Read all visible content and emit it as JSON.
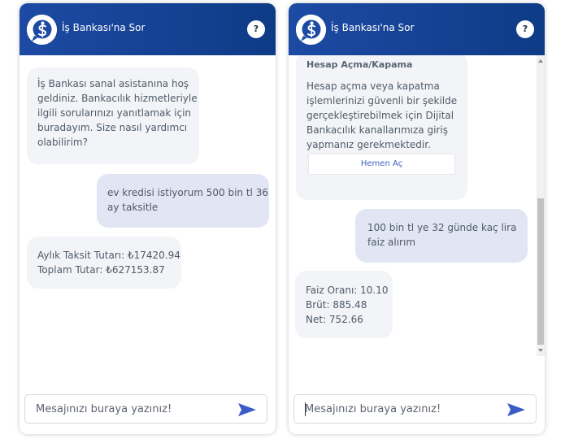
{
  "brand_color": "#1d4aa3",
  "left": {
    "header": {
      "title": "İş Bankası'na Sor",
      "help": "?"
    },
    "messages": [
      {
        "from": "bot",
        "lines": [
          "İş Bankası sanal asistanına hoş",
          "geldiniz. Bankacılık hizmetleriyle",
          "ilgili sorularınızı yanıtlamak için",
          "buradayım. Size nasıl yardımcı",
          "olabilirim?"
        ]
      },
      {
        "from": "user",
        "lines": [
          "ev kredisi istiyorum 500 bin tl 36",
          "ay taksitle"
        ]
      },
      {
        "from": "bot",
        "lines": [
          "Aylık Taksit Tutarı: ₺17420.94",
          "Toplam Tutar: ₺627153.87"
        ]
      }
    ],
    "composer": {
      "placeholder": "Mesajınızı buraya yazınız!"
    }
  },
  "right": {
    "header": {
      "title": "İş Bankası'na Sor",
      "help": "?"
    },
    "card": {
      "title": "Hesap Açma/Kapama",
      "lines": [
        "Hesap açma veya kapatma",
        "işlemlerinizi güvenli bir şekilde",
        "gerçekleştirebilmek için Dijital",
        "Bankacılık kanallarımıza giriş",
        "yapmanız gerekmektedir."
      ],
      "action": "Hemen Aç"
    },
    "messages": [
      {
        "from": "user",
        "lines": [
          "100 bin tl ye 32 günde kaç lira",
          "faiz alırım"
        ]
      },
      {
        "from": "bot",
        "lines": [
          "Faiz Oranı: 10.10",
          "Brüt: 885.48",
          "Net: 752.66"
        ]
      }
    ],
    "composer": {
      "placeholder": "Mesajınızı buraya yazınız!"
    }
  }
}
